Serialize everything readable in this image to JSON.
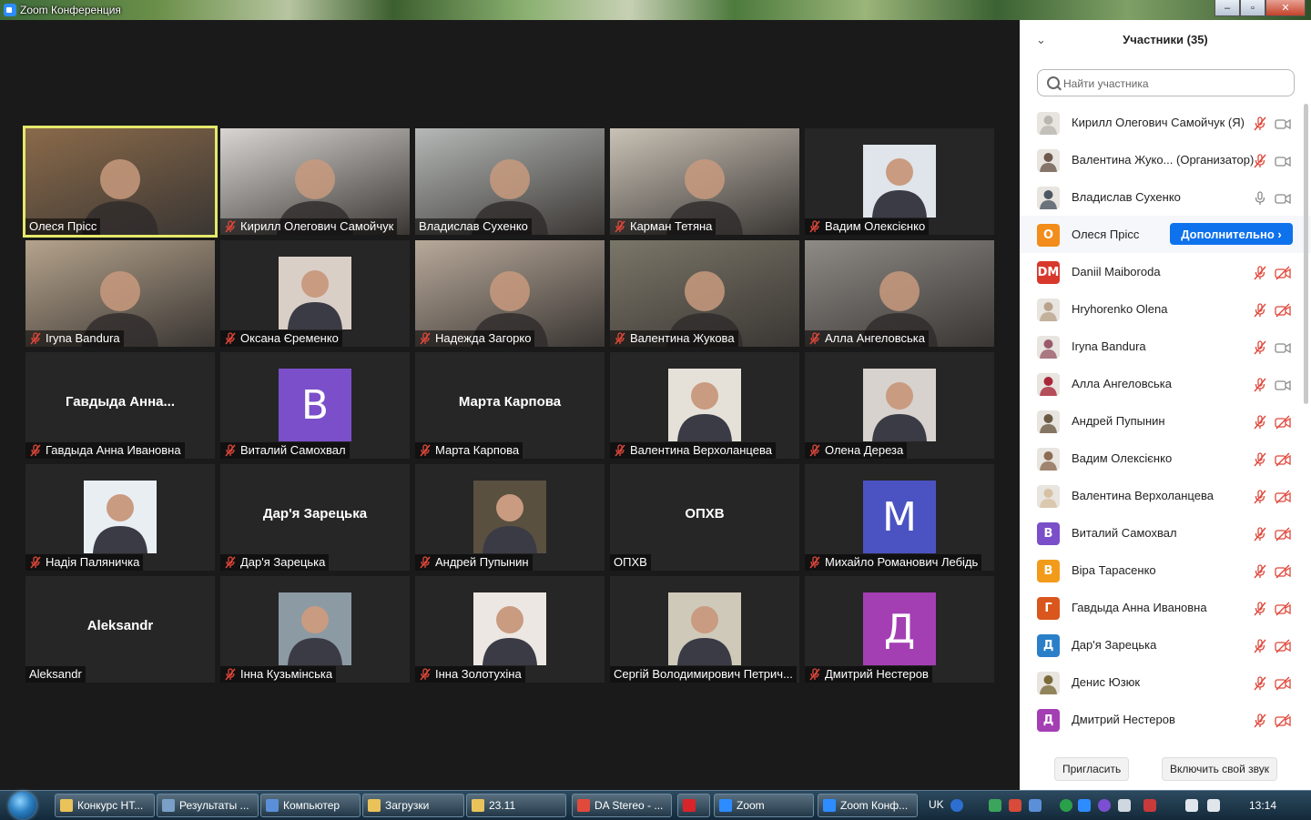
{
  "window": {
    "title": "Zoom Конференция",
    "min": "‒",
    "max": "▫",
    "close": "✕"
  },
  "tiles": [
    {
      "label": "Олеся Прісс",
      "muted": false,
      "type": "cam",
      "bg": "#8a6a4a",
      "active": true
    },
    {
      "label": "Кирилл Олегович Самойчук",
      "muted": true,
      "type": "cam",
      "bg": "#d8d6d2"
    },
    {
      "label": "Владислав Сухенко",
      "muted": false,
      "type": "cam",
      "bg": "#b4b8b6"
    },
    {
      "label": "Карман Тетяна",
      "muted": true,
      "type": "cam",
      "bg": "#c9c2b6"
    },
    {
      "label": "Вадим Олексієнко",
      "muted": true,
      "type": "photo",
      "bg": "#dfe5ea"
    },
    {
      "label": "Iryna Bandura",
      "muted": true,
      "type": "cam",
      "bg": "#b5a38c"
    },
    {
      "label": "Оксана Єременко",
      "muted": true,
      "type": "photo",
      "bg": "#d9cfc7"
    },
    {
      "label": "Надежда Загорко",
      "muted": true,
      "type": "cam",
      "bg": "#b8a99a"
    },
    {
      "label": "Валентина Жукова",
      "muted": true,
      "type": "cam",
      "bg": "#7a7668"
    },
    {
      "label": "Алла Ангеловська",
      "muted": true,
      "type": "cam",
      "bg": "#8e8a86"
    },
    {
      "label": "Гавдыда Анна Ивановна",
      "muted": true,
      "type": "name",
      "bigname": "Гавдыда  Анна..."
    },
    {
      "label": "Виталий Самохвал",
      "muted": true,
      "type": "letter",
      "letter": "В",
      "color": "#7b4fc9"
    },
    {
      "label": "Марта Карпова",
      "muted": true,
      "type": "name",
      "bigname": "Марта Карпова"
    },
    {
      "label": "Валентина Верхоланцева",
      "muted": true,
      "type": "photo",
      "bg": "#e6e1d8"
    },
    {
      "label": "Олена Дереза",
      "muted": true,
      "type": "photo",
      "bg": "#d7d2cd"
    },
    {
      "label": "Надія Паляничка",
      "muted": true,
      "type": "photo",
      "bg": "#e9eef3"
    },
    {
      "label": "Дар'я Зарецька",
      "muted": true,
      "type": "name",
      "bigname": "Дар'я Зарецька"
    },
    {
      "label": "Андрей Пупынин",
      "muted": true,
      "type": "photo",
      "bg": "#5a5040"
    },
    {
      "label": "ОПХВ",
      "muted": false,
      "type": "name",
      "bigname": "ОПХВ"
    },
    {
      "label": "Михайло Романович Лебідь",
      "muted": true,
      "type": "letter",
      "letter": "М",
      "color": "#4b53c2"
    },
    {
      "label": "Aleksandr",
      "muted": false,
      "type": "name",
      "bigname": "Aleksandr"
    },
    {
      "label": "Інна Кузьмінська",
      "muted": true,
      "type": "photo",
      "bg": "#8c9aa3"
    },
    {
      "label": "Інна Золотухіна",
      "muted": true,
      "type": "photo",
      "bg": "#ece7e2"
    },
    {
      "label": "Сергій Володимирович Петрич...",
      "muted": false,
      "type": "photo",
      "bg": "#cfc9b9"
    },
    {
      "label": "Дмитрий Нестеров",
      "muted": true,
      "type": "letter",
      "letter": "Д",
      "color": "#a33fb3"
    }
  ],
  "panel": {
    "title": "Участники (35)",
    "search_placeholder": "Найти участника",
    "more_button": "Дополнительно ›",
    "invite_button": "Пригласить",
    "unmute_button": "Включить свой звук",
    "participants": [
      {
        "name": "Кирилл Олегович Самойчук (Я)",
        "avatar": "photo",
        "avcolor": "#b9b6b0",
        "mic": "off",
        "cam": "on"
      },
      {
        "name": "Валентина Жуко... (Организатор)",
        "avatar": "photo",
        "avcolor": "#6d5a4c",
        "mic": "off",
        "cam": "on"
      },
      {
        "name": "Владислав Сухенко",
        "avatar": "photo",
        "avcolor": "#4d5663",
        "mic": "on",
        "cam": "on"
      },
      {
        "name": "Олеся Прісс",
        "avatar": "letter",
        "letter": "О",
        "avcolor": "#f28c1a",
        "mic": "",
        "cam": "",
        "hover": true
      },
      {
        "name": "Daniil Maiboroda",
        "avatar": "letter",
        "letter": "DM",
        "avcolor": "#d8372b",
        "mic": "off",
        "cam": "off"
      },
      {
        "name": "Hryhorenko Olena",
        "avatar": "photo",
        "avcolor": "#b9a28c",
        "mic": "off",
        "cam": "off"
      },
      {
        "name": "Iryna Bandura",
        "avatar": "photo",
        "avcolor": "#9a5b6a",
        "mic": "off",
        "cam": "on"
      },
      {
        "name": "Алла Ангеловська",
        "avatar": "photo",
        "avcolor": "#a8283a",
        "mic": "off",
        "cam": "on"
      },
      {
        "name": "Андрей Пупынин",
        "avatar": "photo",
        "avcolor": "#6b5a44",
        "mic": "off",
        "cam": "off"
      },
      {
        "name": "Вадим Олексієнко",
        "avatar": "photo",
        "avcolor": "#8c6c52",
        "mic": "off",
        "cam": "off"
      },
      {
        "name": "Валентина Верхоланцева",
        "avatar": "photo",
        "avcolor": "#d6c1a3",
        "mic": "off",
        "cam": "off"
      },
      {
        "name": "Виталий Самохвал",
        "avatar": "letter",
        "letter": "В",
        "avcolor": "#7b4fc9",
        "mic": "off",
        "cam": "off"
      },
      {
        "name": "Віра Тарасенко",
        "avatar": "letter",
        "letter": "В",
        "avcolor": "#f29b1a",
        "mic": "off",
        "cam": "off"
      },
      {
        "name": "Гавдыда Анна Ивановна",
        "avatar": "letter",
        "letter": "Г",
        "avcolor": "#d9561c",
        "mic": "off",
        "cam": "off"
      },
      {
        "name": "Дар'я Зарецька",
        "avatar": "letter",
        "letter": "Д",
        "avcolor": "#2a7fc8",
        "mic": "off",
        "cam": "off"
      },
      {
        "name": "Денис Юзюк",
        "avatar": "photo",
        "avcolor": "#7a6a3a",
        "mic": "off",
        "cam": "off"
      },
      {
        "name": "Дмитрий Нестеров",
        "avatar": "letter",
        "letter": "Д",
        "avcolor": "#a33fb3",
        "mic": "off",
        "cam": "off"
      }
    ]
  },
  "taskbar": {
    "items": [
      {
        "label": "Конкурс НТ...",
        "icolor": "#e9c35a"
      },
      {
        "label": "Результаты ...",
        "icolor": "#7aa0c8"
      },
      {
        "label": "Компьютер",
        "icolor": "#5b8fd8"
      },
      {
        "label": "Загрузки",
        "icolor": "#e9c35a"
      },
      {
        "label": "23.11",
        "icolor": "#e9c35a"
      },
      {
        "label": "DA Stereo - ...",
        "icolor": "#e04a3a"
      },
      {
        "label": "",
        "icolor": "#d8242a"
      },
      {
        "label": "Zoom",
        "icolor": "#2d8cff"
      },
      {
        "label": "Zoom Конф...",
        "icolor": "#2d8cff"
      }
    ],
    "lang": "UK",
    "clock": "13:14"
  }
}
